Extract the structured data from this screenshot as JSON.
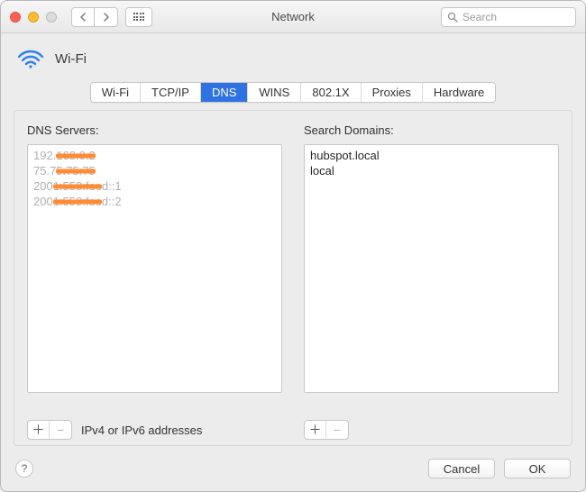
{
  "window": {
    "title": "Network"
  },
  "toolbar": {
    "search_placeholder": "Search"
  },
  "interface": {
    "name": "Wi-Fi"
  },
  "tabs": [
    {
      "label": "Wi-Fi",
      "selected": false
    },
    {
      "label": "TCP/IP",
      "selected": false
    },
    {
      "label": "DNS",
      "selected": true
    },
    {
      "label": "WINS",
      "selected": false
    },
    {
      "label": "802.1X",
      "selected": false
    },
    {
      "label": "Proxies",
      "selected": false
    },
    {
      "label": "Hardware",
      "selected": false
    }
  ],
  "dns": {
    "label": "DNS Servers:",
    "hint": "IPv4 or IPv6 addresses",
    "servers": [
      {
        "prefix": "192.",
        "redacted": "168.0.2",
        "suffix": ""
      },
      {
        "prefix": "75.7",
        "redacted": "5.75.75",
        "suffix": ""
      },
      {
        "prefix": "200",
        "redacted": "1:558:fee",
        "suffix": "d::1"
      },
      {
        "prefix": "200",
        "redacted": "1:558:fee",
        "suffix": "d::2"
      }
    ]
  },
  "search_domains": {
    "label": "Search Domains:",
    "items": [
      "hubspot.local",
      "local"
    ]
  },
  "footer": {
    "cancel": "Cancel",
    "ok": "OK"
  },
  "icons": {
    "plus": "＋",
    "minus": "−",
    "help": "?"
  }
}
